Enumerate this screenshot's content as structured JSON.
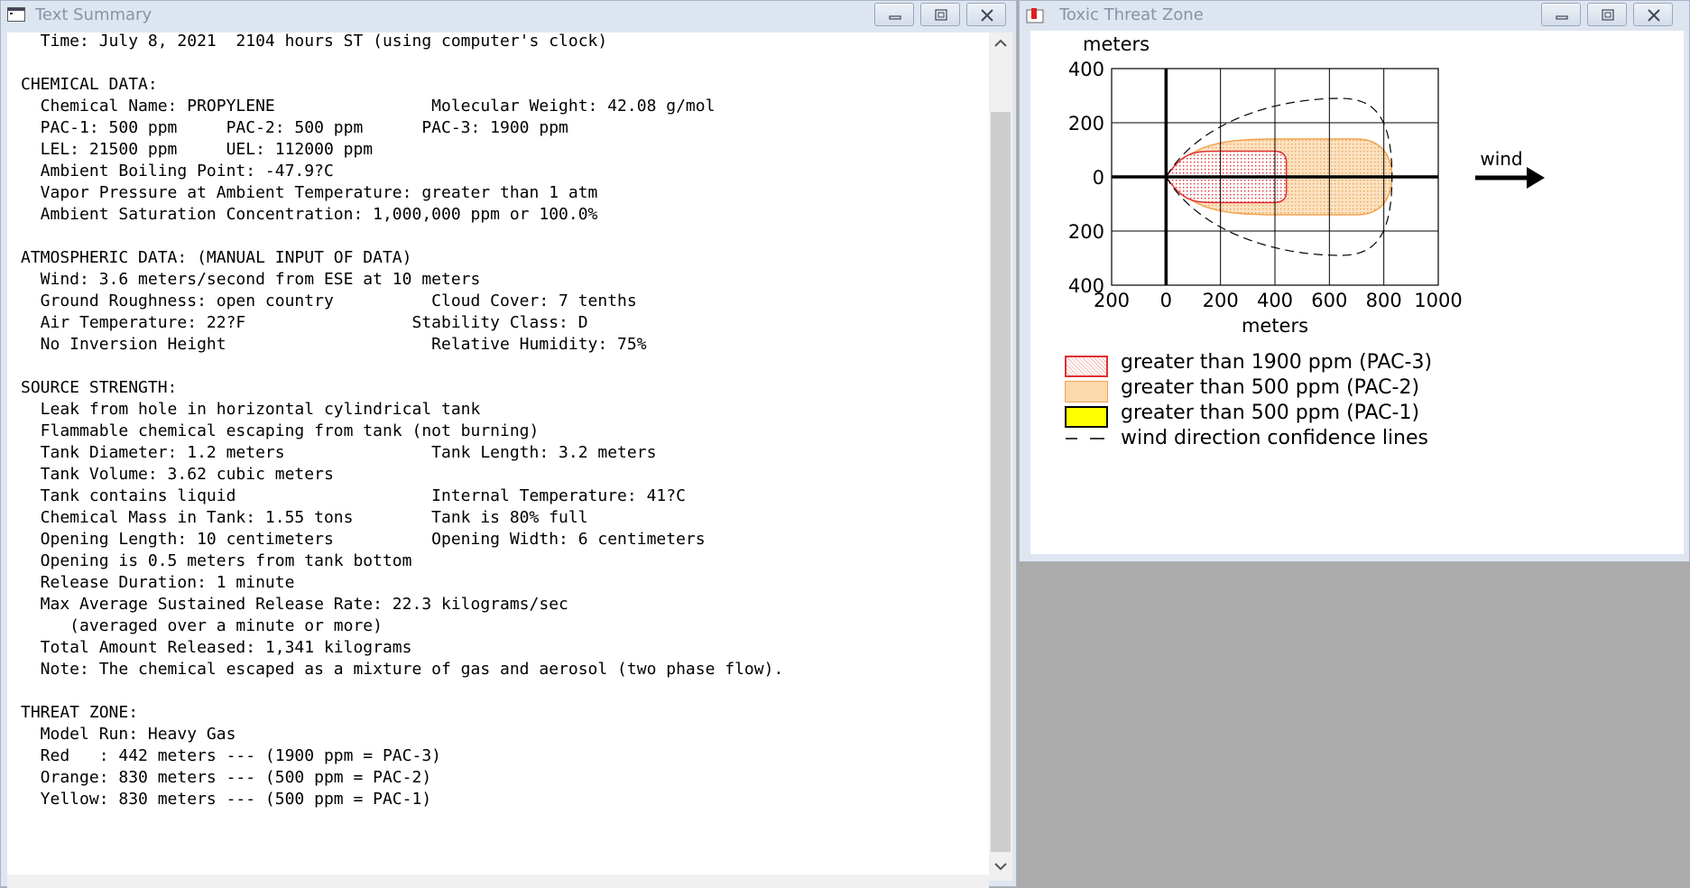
{
  "text_window": {
    "title": "Text Summary",
    "lines": [
      "  Time: July 8, 2021  2104 hours ST (using computer's clock)",
      "",
      "CHEMICAL DATA:",
      "  Chemical Name: PROPYLENE                Molecular Weight: 42.08 g/mol",
      "  PAC-1: 500 ppm     PAC-2: 500 ppm      PAC-3: 1900 ppm",
      "  LEL: 21500 ppm     UEL: 112000 ppm",
      "  Ambient Boiling Point: -47.9?C",
      "  Vapor Pressure at Ambient Temperature: greater than 1 atm",
      "  Ambient Saturation Concentration: 1,000,000 ppm or 100.0%",
      "",
      "ATMOSPHERIC DATA: (MANUAL INPUT OF DATA)",
      "  Wind: 3.6 meters/second from ESE at 10 meters",
      "  Ground Roughness: open country          Cloud Cover: 7 tenths",
      "  Air Temperature: 22?F                 Stability Class: D",
      "  No Inversion Height                     Relative Humidity: 75%",
      "",
      "SOURCE STRENGTH:",
      "  Leak from hole in horizontal cylindrical tank",
      "  Flammable chemical escaping from tank (not burning)",
      "  Tank Diameter: 1.2 meters               Tank Length: 3.2 meters",
      "  Tank Volume: 3.62 cubic meters",
      "  Tank contains liquid                    Internal Temperature: 41?C",
      "  Chemical Mass in Tank: 1.55 tons        Tank is 80% full",
      "  Opening Length: 10 centimeters          Opening Width: 6 centimeters",
      "  Opening is 0.5 meters from tank bottom",
      "  Release Duration: 1 minute",
      "  Max Average Sustained Release Rate: 22.3 kilograms/sec",
      "     (averaged over a minute or more)",
      "  Total Amount Released: 1,341 kilograms",
      "  Note: The chemical escaped as a mixture of gas and aerosol (two phase flow).",
      "",
      "THREAT ZONE:",
      "  Model Run: Heavy Gas",
      "  Red   : 442 meters --- (1900 ppm = PAC-3)",
      "  Orange: 830 meters --- (500 ppm = PAC-2)",
      "  Yellow: 830 meters --- (500 ppm = PAC-1)"
    ]
  },
  "chart_window": {
    "title": "Toxic Threat Zone",
    "wind_label": "wind",
    "legend": [
      {
        "label": "greater than 1900 ppm (PAC-3)",
        "color": "#e03030",
        "style": "dotted-fill"
      },
      {
        "label": "greater than 500 ppm (PAC-2)",
        "color": "#f7b56b",
        "style": "dotted-fill"
      },
      {
        "label": "greater than 500 ppm (PAC-1)",
        "color": "#ffff00",
        "style": "solid-fill"
      },
      {
        "label": "wind direction confidence lines",
        "color": "#000000",
        "style": "dashed-line"
      }
    ]
  },
  "chart_data": {
    "type": "area",
    "xlabel": "meters",
    "ylabel": "meters",
    "xlim": [
      -200,
      1000
    ],
    "ylim": [
      -400,
      400
    ],
    "x_ticks": [
      "200",
      "0",
      "200",
      "400",
      "600",
      "800",
      "1000"
    ],
    "y_ticks": [
      "400",
      "200",
      "0",
      "200",
      "400"
    ],
    "grid": true,
    "zones": [
      {
        "name": "PAC-3",
        "max_downwind_m": 442,
        "max_halfwidth_m": 95,
        "color": "#e03030"
      },
      {
        "name": "PAC-2",
        "max_downwind_m": 830,
        "max_halfwidth_m": 140,
        "color": "#f7b56b"
      },
      {
        "name": "PAC-1",
        "max_downwind_m": 830,
        "max_halfwidth_m": 140,
        "color": "#ffff00"
      }
    ],
    "confidence_lines": {
      "max_downwind_m": 830,
      "max_halfwidth_m": 290
    }
  }
}
